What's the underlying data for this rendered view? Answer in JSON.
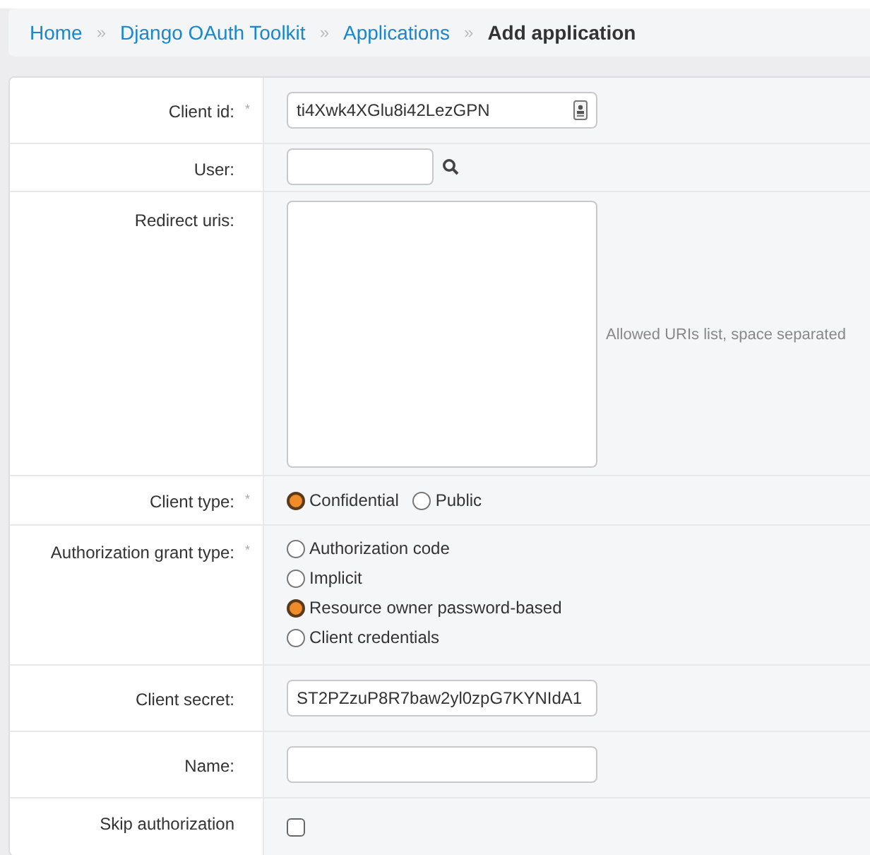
{
  "breadcrumbs": [
    {
      "label": "Home",
      "link": true
    },
    {
      "label": "Django OAuth Toolkit",
      "link": true
    },
    {
      "label": "Applications",
      "link": true
    },
    {
      "label": "Add application",
      "link": false
    }
  ],
  "separator": "»",
  "fields": [
    {
      "kind": "text",
      "label": "Client id:",
      "marker": "*",
      "value": "ti4Xwk4XGlu8i42LezGPN",
      "contact_icon": true
    },
    {
      "kind": "lookup",
      "label": "User:"
    },
    {
      "kind": "textarea",
      "label": "Redirect uris:",
      "help": "Allowed URIs list, space separated"
    },
    {
      "kind": "radio-inline",
      "label": "Client type:",
      "marker": "*",
      "options": [
        {
          "label": "Confidential",
          "selected": true
        },
        {
          "label": "Public",
          "selected": false
        }
      ]
    },
    {
      "kind": "radio-list",
      "label": "Authorization grant type:",
      "marker": "*",
      "options": [
        {
          "label": "Authorization code",
          "selected": false
        },
        {
          "label": "Implicit",
          "selected": false
        },
        {
          "label": "Resource owner password-based",
          "selected": true
        },
        {
          "label": "Client credentials",
          "selected": false
        }
      ]
    },
    {
      "kind": "text",
      "label": "Client secret:",
      "value": "ST2PZzuP8R7baw2yl0zpG7KYNIdA1"
    },
    {
      "kind": "text",
      "label": "Name:"
    },
    {
      "kind": "checkbox",
      "label": "Skip authorization",
      "checked": false
    }
  ]
}
